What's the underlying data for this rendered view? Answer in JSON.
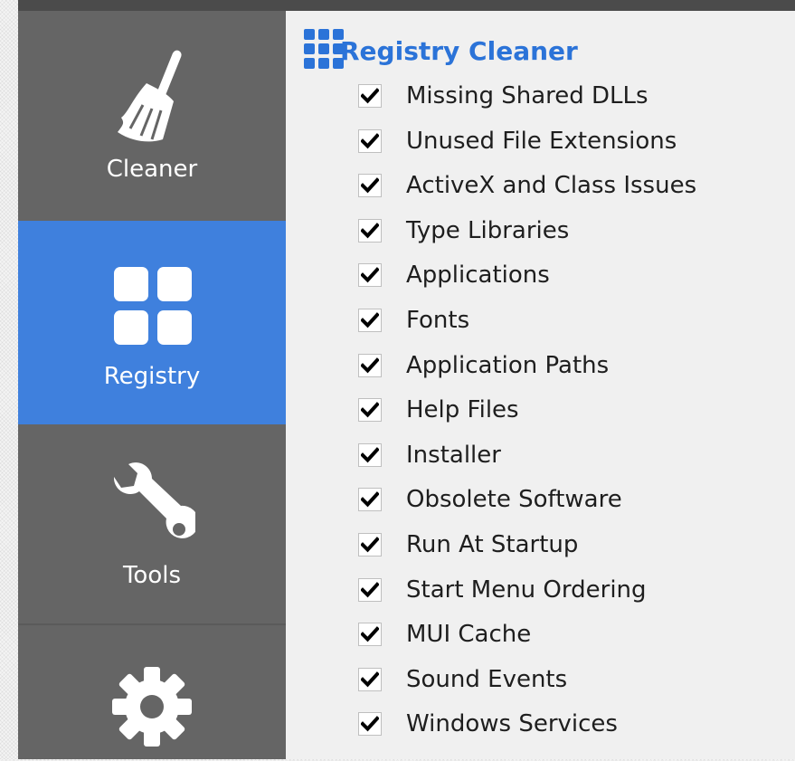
{
  "sidebar": {
    "items": [
      {
        "label": "Cleaner",
        "icon": "broom-icon",
        "active": false
      },
      {
        "label": "Registry",
        "icon": "grid-icon",
        "active": true
      },
      {
        "label": "Tools",
        "icon": "wrench-icon",
        "active": false
      },
      {
        "label": "",
        "icon": "gear-icon",
        "active": false
      }
    ]
  },
  "main": {
    "title": "Registry Cleaner",
    "title_icon": "registry-grid-icon",
    "items": [
      {
        "label": "Missing Shared DLLs",
        "checked": true
      },
      {
        "label": "Unused File Extensions",
        "checked": true
      },
      {
        "label": "ActiveX and Class Issues",
        "checked": true
      },
      {
        "label": "Type Libraries",
        "checked": true
      },
      {
        "label": "Applications",
        "checked": true
      },
      {
        "label": "Fonts",
        "checked": true
      },
      {
        "label": "Application Paths",
        "checked": true
      },
      {
        "label": "Help Files",
        "checked": true
      },
      {
        "label": "Installer",
        "checked": true
      },
      {
        "label": "Obsolete Software",
        "checked": true
      },
      {
        "label": "Run At Startup",
        "checked": true
      },
      {
        "label": "Start Menu Ordering",
        "checked": true
      },
      {
        "label": "MUI Cache",
        "checked": true
      },
      {
        "label": "Sound Events",
        "checked": true
      },
      {
        "label": "Windows Services",
        "checked": true
      }
    ]
  },
  "colors": {
    "sidebar_bg": "#656565",
    "active_bg": "#3f80dd",
    "title": "#2b73d8",
    "main_bg": "#f0f0f0"
  }
}
